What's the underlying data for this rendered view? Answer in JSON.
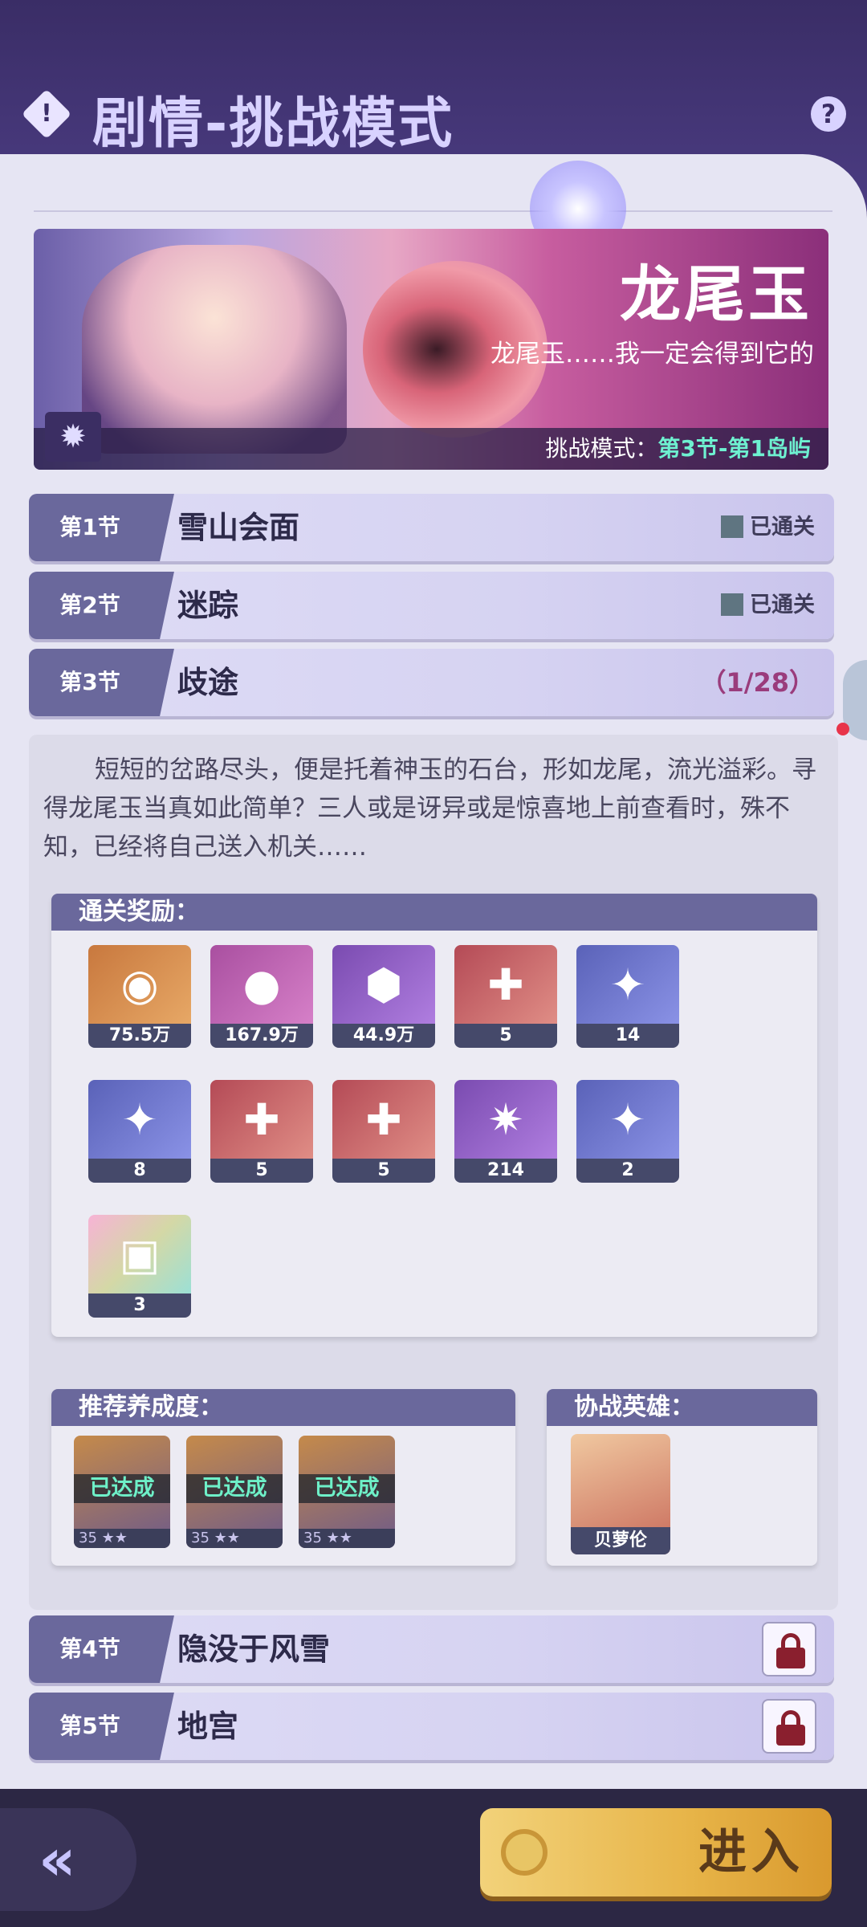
{
  "header": {
    "title": "剧情-挑战模式",
    "left_icon": "alert-diamond-icon",
    "right_icon": "help-icon"
  },
  "banner": {
    "title": "龙尾玉",
    "subtitle": "龙尾玉……我一定会得到它的",
    "mode_label": "挑战模式：",
    "mode_value": "第3节-第1岛屿"
  },
  "chapters": [
    {
      "num": "第1节",
      "name": "雪山会面",
      "status": "已通关"
    },
    {
      "num": "第2节",
      "name": "迷踪",
      "status": "已通关"
    },
    {
      "num": "第3节",
      "name": "歧途",
      "progress": "（1/28）"
    },
    {
      "num": "第4节",
      "name": "隐没于风雪"
    },
    {
      "num": "第5节",
      "name": "地宫"
    }
  ],
  "detail": {
    "story": "短短的岔路尽头，便是托着神玉的石台，形如龙尾，流光溢彩。寻得龙尾玉当真如此简单？三人或是讶异或是惊喜地上前查看时，殊不知，已经将自己送入机关……",
    "rewards_title": "通关奖励：",
    "rewards": [
      {
        "count": "75.5万",
        "color": "orange",
        "icon": "gold-coin-icon"
      },
      {
        "count": "167.9万",
        "color": "pink",
        "icon": "pink-orb-icon"
      },
      {
        "count": "44.9万",
        "color": "purple",
        "icon": "blue-gem-icon"
      },
      {
        "count": "5",
        "color": "red",
        "icon": "robot-puzzle-icon"
      },
      {
        "count": "14",
        "color": "blue",
        "icon": "diamond-icon"
      },
      {
        "count": "8",
        "color": "blue",
        "icon": "double-diamond-icon"
      },
      {
        "count": "5",
        "color": "red",
        "icon": "monkey-puzzle-icon"
      },
      {
        "count": "5",
        "color": "red",
        "icon": "lady-puzzle-icon"
      },
      {
        "count": "214",
        "color": "purple",
        "icon": "star-crystal-icon"
      },
      {
        "count": "2",
        "color": "blue",
        "icon": "triple-diamond-icon"
      },
      {
        "count": "3",
        "color": "rainbow",
        "icon": "coin-card-icon"
      }
    ],
    "recommend_title": "推荐养成度：",
    "recommend": [
      {
        "tag": "已达成",
        "level": "35",
        "stars": "★★"
      },
      {
        "tag": "已达成",
        "level": "35",
        "stars": "★★"
      },
      {
        "tag": "已达成",
        "level": "35",
        "stars": "★★"
      }
    ],
    "helper_title": "协战英雄：",
    "helper": {
      "name": "贝萝伦"
    }
  },
  "bottom": {
    "enter_label": "进入",
    "back_icon": "back-arrow-icon"
  }
}
